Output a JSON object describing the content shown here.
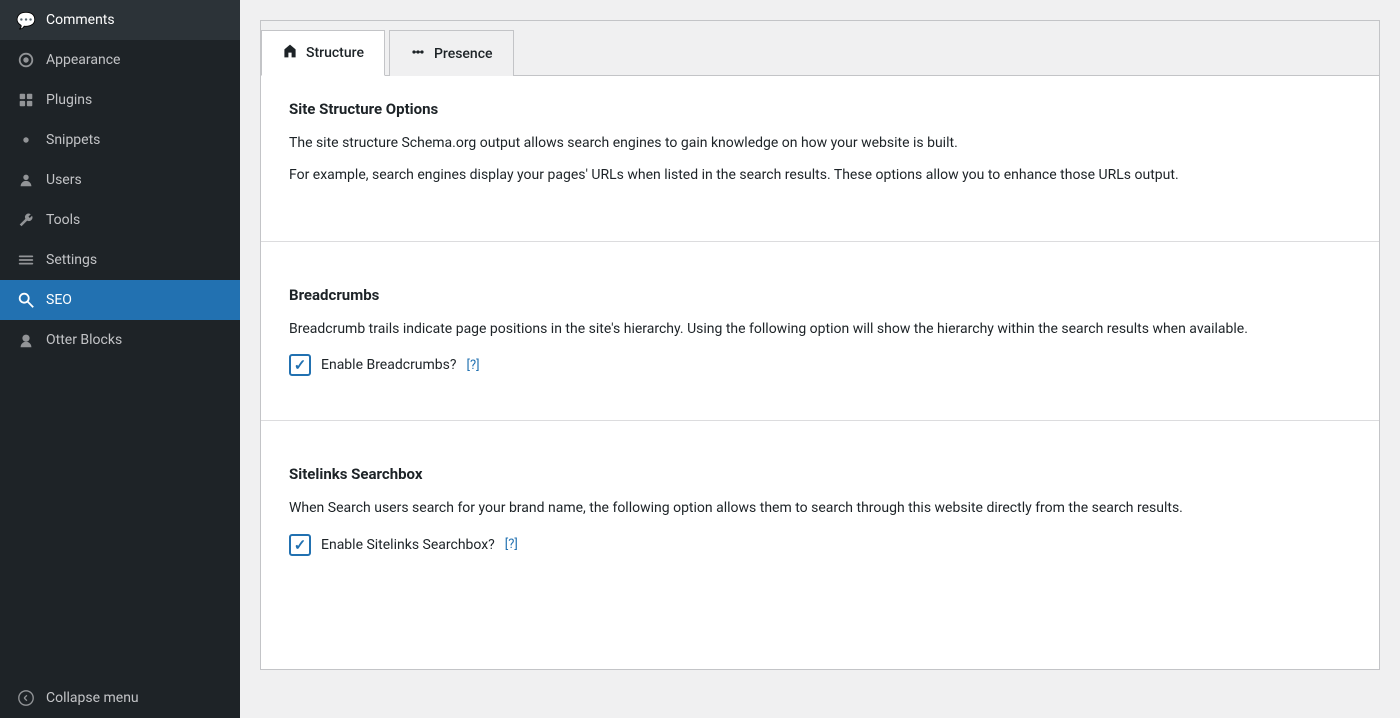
{
  "sidebar": {
    "items": [
      {
        "id": "comments",
        "label": "Comments",
        "icon": "💬",
        "active": false
      },
      {
        "id": "appearance",
        "label": "Appearance",
        "icon": "🎨",
        "active": false
      },
      {
        "id": "plugins",
        "label": "Plugins",
        "icon": "🔌",
        "active": false
      },
      {
        "id": "snippets",
        "label": "Snippets",
        "icon": "⚙️",
        "active": false
      },
      {
        "id": "users",
        "label": "Users",
        "icon": "👤",
        "active": false
      },
      {
        "id": "tools",
        "label": "Tools",
        "icon": "🔧",
        "active": false
      },
      {
        "id": "settings",
        "label": "Settings",
        "icon": "📊",
        "active": false
      },
      {
        "id": "seo",
        "label": "SEO",
        "icon": "🔍",
        "active": true
      },
      {
        "id": "otter-blocks",
        "label": "Otter Blocks",
        "icon": "👤",
        "active": false
      }
    ],
    "collapse_label": "Collapse menu"
  },
  "tabs": [
    {
      "id": "structure",
      "label": "Structure",
      "icon": "🏠",
      "active": true
    },
    {
      "id": "presence",
      "label": "Presence",
      "icon": "📊",
      "active": false
    }
  ],
  "main": {
    "site_structure": {
      "title": "Site Structure Options",
      "desc1": "The site structure Schema.org output allows search engines to gain knowledge on how your website is built.",
      "desc2": "For example, search engines display your pages' URLs when listed in the search results. These options allow you to enhance those URLs output."
    },
    "breadcrumbs": {
      "title": "Breadcrumbs",
      "desc": "Breadcrumb trails indicate page positions in the site's hierarchy. Using the following option will show the hierarchy within the search results when available.",
      "checkbox_label": "Enable Breadcrumbs?",
      "help_text": "[?]",
      "checked": true
    },
    "sitelinks": {
      "title": "Sitelinks Searchbox",
      "desc": "When Search users search for your brand name, the following option allows them to search through this website directly from the search results.",
      "checkbox_label": "Enable Sitelinks Searchbox?",
      "help_text": "[?]",
      "checked": true
    }
  }
}
